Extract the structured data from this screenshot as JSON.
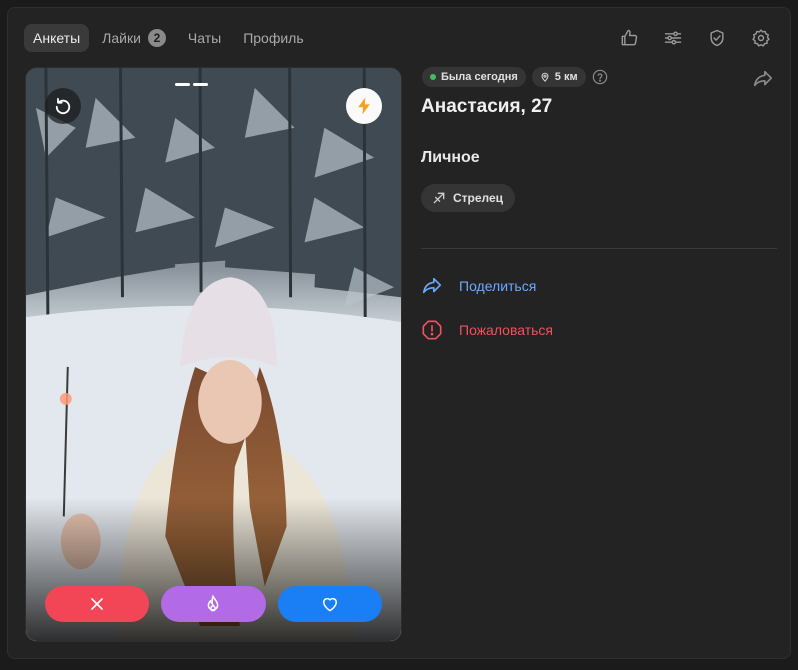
{
  "nav": {
    "tabs": [
      {
        "label": "Анкеты",
        "active": true
      },
      {
        "label": "Лайки",
        "badge": "2"
      },
      {
        "label": "Чаты"
      },
      {
        "label": "Профиль"
      }
    ],
    "icons": [
      "thumbs-up-icon",
      "filters-icon",
      "shield-check-icon",
      "gear-icon"
    ]
  },
  "photo": {
    "photo_index": 2,
    "photo_count": 2,
    "undo_icon": "undo-icon",
    "boost_icon": "lightning-icon",
    "actions": [
      "close-icon",
      "flame-icon",
      "heart-icon"
    ],
    "colors": {
      "dislike": "#f24555",
      "super": "#b36ae6",
      "like": "#1a7ef5",
      "boost": "#f4a21a"
    }
  },
  "profile": {
    "status": "Была сегодня",
    "distance": "5 км",
    "name_age": "Анастасия, 27",
    "section_title": "Личное",
    "tags": [
      {
        "label": "Стрелец",
        "icon": "sagittarius-icon"
      }
    ]
  },
  "links": {
    "share": "Поделиться",
    "report": "Пожаловаться"
  },
  "colors": {
    "online": "#3fbf5f",
    "link": "#6ea8ff",
    "danger": "#f0515f"
  }
}
